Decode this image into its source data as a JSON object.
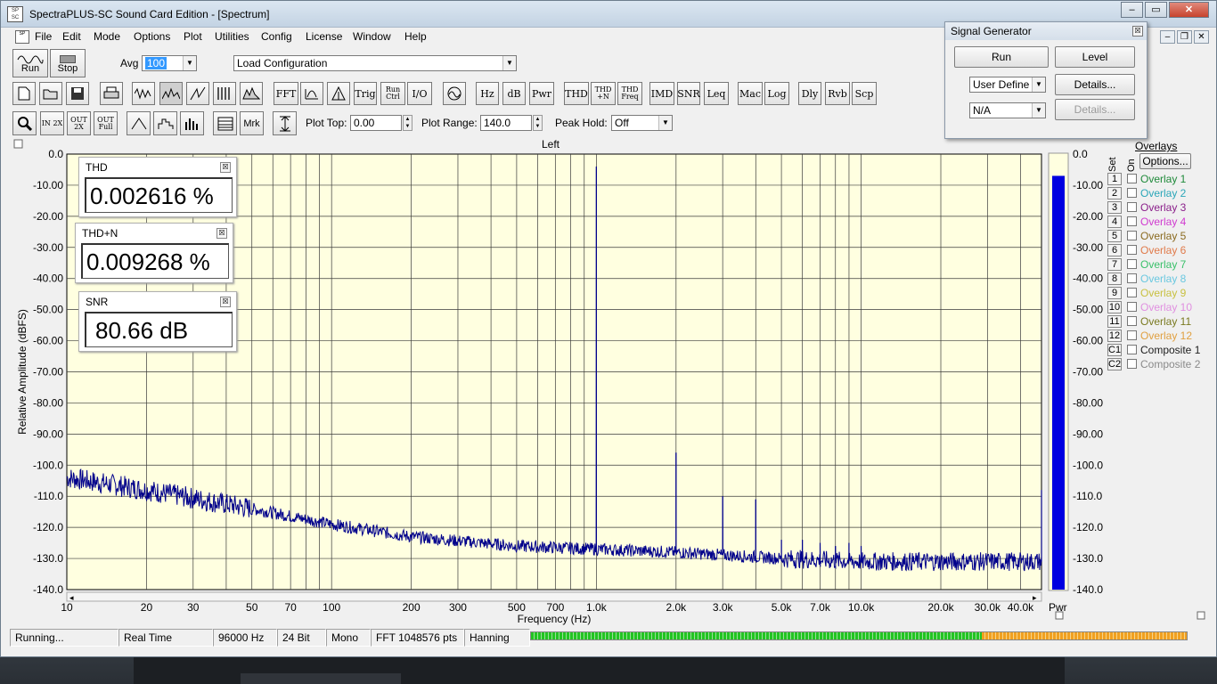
{
  "window": {
    "title": "SpectraPLUS-SC Sound Card Edition - [Spectrum]",
    "app_icon_text": "SP SC"
  },
  "menu": {
    "items": [
      "File",
      "Edit",
      "Mode",
      "Options",
      "Plot",
      "Utilities",
      "Config",
      "License",
      "Window",
      "Help"
    ]
  },
  "toolbar1": {
    "run_label": "Run",
    "stop_label": "Stop",
    "avg_label": "Avg",
    "avg_value": "100",
    "config_value": "Load Configuration"
  },
  "toolbar2": {
    "buttons": [
      "FFT",
      "Trig",
      "Run Ctrl",
      "I/O",
      "Hz",
      "dB",
      "Pwr",
      "THD",
      "THD +N",
      "THD Freq",
      "IMD",
      "SNR",
      "Leq",
      "Mac",
      "Log",
      "Dly",
      "Rvb",
      "Scp"
    ]
  },
  "toolbar3": {
    "zoom_in": "IN 2X",
    "zoom_out": "OUT 2X",
    "full": "OUT Full",
    "mrk": "Mrk",
    "plot_top_label": "Plot Top:",
    "plot_top_value": "0.00",
    "plot_range_label": "Plot Range:",
    "plot_range_value": "140.0",
    "peak_hold_label": "Peak Hold:",
    "peak_hold_value": "Off"
  },
  "meters": {
    "thd": {
      "title": "THD",
      "value": "0.002616 %"
    },
    "thdn": {
      "title": "THD+N",
      "value": "0.009268 %"
    },
    "snr": {
      "title": "SNR",
      "value": "80.66 dB"
    }
  },
  "overlays": {
    "header": "Overlays",
    "options_label": "Options...",
    "set_label": "Set",
    "on_label": "On",
    "items": [
      {
        "set": "1",
        "name": "Overlay 1",
        "color": "#1f8a3a"
      },
      {
        "set": "2",
        "name": "Overlay 2",
        "color": "#2aa6b8"
      },
      {
        "set": "3",
        "name": "Overlay 3",
        "color": "#8a1f8a"
      },
      {
        "set": "4",
        "name": "Overlay 4",
        "color": "#d03ad0"
      },
      {
        "set": "5",
        "name": "Overlay 5",
        "color": "#8a6a1f"
      },
      {
        "set": "6",
        "name": "Overlay 6",
        "color": "#e07a4a"
      },
      {
        "set": "7",
        "name": "Overlay 7",
        "color": "#3ac06a"
      },
      {
        "set": "8",
        "name": "Overlay 8",
        "color": "#6ac8e0"
      },
      {
        "set": "9",
        "name": "Overlay 9",
        "color": "#c8c040"
      },
      {
        "set": "10",
        "name": "Overlay 10",
        "color": "#e090e0"
      },
      {
        "set": "11",
        "name": "Overlay 11",
        "color": "#7a7a20"
      },
      {
        "set": "12",
        "name": "Overlay 12",
        "color": "#e0a040"
      },
      {
        "set": "C1",
        "name": "Composite 1",
        "color": "#202020"
      },
      {
        "set": "C2",
        "name": "Composite 2",
        "color": "#8a8a8a"
      }
    ]
  },
  "signal_generator": {
    "title": "Signal Generator",
    "run_label": "Run",
    "level_label": "Level",
    "type_value": "User Define",
    "details1_label": "Details...",
    "sub_value": "N/A",
    "details2_label": "Details..."
  },
  "status": {
    "state": "Running...",
    "mode": "Real Time",
    "rate": "96000 Hz",
    "bits": "24 Bit",
    "channels": "Mono",
    "fft": "FFT 1048576 pts",
    "window": "Hanning"
  },
  "chart_data": {
    "type": "line",
    "title": "Left",
    "xlabel": "Frequency (Hz)",
    "ylabel": "Relative Amplitude (dBFS)",
    "x_scale": "log",
    "xlim": [
      10,
      48000
    ],
    "ylim": [
      -140,
      0
    ],
    "x_tick_labels": [
      "10",
      "20",
      "30",
      "50",
      "70",
      "100",
      "200",
      "300",
      "500",
      "700",
      "1.0k",
      "2.0k",
      "3.0k",
      "5.0k",
      "7.0k",
      "10.0k",
      "20.0k",
      "30.0k",
      "40.0k"
    ],
    "x_ticks": [
      10,
      20,
      30,
      50,
      70,
      100,
      200,
      300,
      500,
      700,
      1000,
      2000,
      3000,
      5000,
      7000,
      10000,
      20000,
      30000,
      40000
    ],
    "y_tick_labels": [
      "0.0",
      "-10.00",
      "-20.00",
      "-30.00",
      "-40.00",
      "-50.00",
      "-60.00",
      "-70.00",
      "-80.00",
      "-90.00",
      "-100.0",
      "-110.0",
      "-120.0",
      "-130.0",
      "-140.0"
    ],
    "y_ticks": [
      0,
      -10,
      -20,
      -30,
      -40,
      -50,
      -60,
      -70,
      -80,
      -90,
      -100,
      -110,
      -120,
      -130,
      -140
    ],
    "grid": true,
    "series": [
      {
        "color": "#00008b",
        "noise_floor": [
          [
            10,
            -104
          ],
          [
            20,
            -108
          ],
          [
            50,
            -114
          ],
          [
            100,
            -119
          ],
          [
            200,
            -123
          ],
          [
            500,
            -126
          ],
          [
            1000,
            -127
          ],
          [
            2000,
            -128
          ],
          [
            5000,
            -130
          ],
          [
            10000,
            -131
          ],
          [
            20000,
            -131
          ],
          [
            48000,
            -131
          ]
        ],
        "peaks": [
          [
            1000,
            -4
          ],
          [
            2000,
            -96
          ],
          [
            3000,
            -110
          ],
          [
            4000,
            -111
          ],
          [
            5000,
            -124
          ],
          [
            6000,
            -124
          ],
          [
            7000,
            -125
          ],
          [
            8000,
            -126
          ],
          [
            9000,
            -125
          ],
          [
            10000,
            -126
          ],
          [
            48000,
            -108
          ]
        ]
      }
    ],
    "pwr_bar": {
      "label": "Pwr",
      "level_db": -7,
      "color": "#0000e0"
    },
    "pwr_ticks": [
      "0.0",
      "-10.00",
      "-20.00",
      "-30.00",
      "-40.00",
      "-50.00",
      "-60.00",
      "-70.00",
      "-80.00",
      "-90.00",
      "-100.0",
      "-110.0",
      "-120.0",
      "-130.0",
      "-140.0"
    ]
  }
}
